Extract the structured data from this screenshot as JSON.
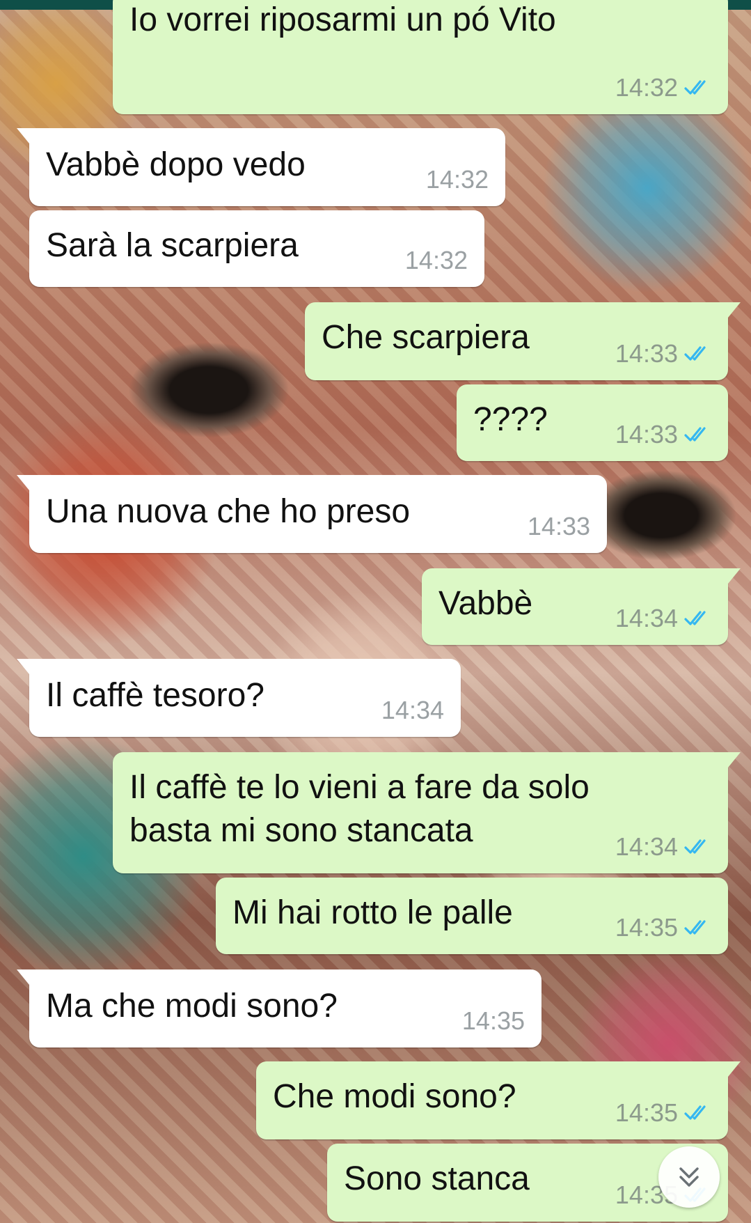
{
  "colors": {
    "outgoing_bubble": "#dcf8c6",
    "incoming_bubble": "#ffffff",
    "read_ticks": "#34b7f1",
    "header_strip": "#0f4f48"
  },
  "icons": {
    "read_receipt": "double-check-icon",
    "scroll_down": "double-chevron-down-icon"
  },
  "messages": [
    {
      "direction": "out",
      "text": "Io vorrei riposarmi un pó Vito",
      "time": "14:32",
      "read": true
    },
    {
      "direction": "in",
      "text": "Vabbè dopo vedo",
      "time": "14:32"
    },
    {
      "direction": "in",
      "text": "Sarà la scarpiera",
      "time": "14:32"
    },
    {
      "direction": "out",
      "text": "Che scarpiera",
      "time": "14:33",
      "read": true
    },
    {
      "direction": "out",
      "text": "????",
      "time": "14:33",
      "read": true
    },
    {
      "direction": "in",
      "text": "Una nuova che ho preso",
      "time": "14:33"
    },
    {
      "direction": "out",
      "text": "Vabbè",
      "time": "14:34",
      "read": true
    },
    {
      "direction": "in",
      "text": "Il caffè tesoro?",
      "time": "14:34"
    },
    {
      "direction": "out",
      "text_lines": [
        "Il caffè te lo vieni a fare da solo",
        "basta mi sono stancata"
      ],
      "time": "14:34",
      "read": true
    },
    {
      "direction": "out",
      "text": "Mi hai rotto le palle",
      "time": "14:35",
      "read": true
    },
    {
      "direction": "in",
      "text": "Ma che modi sono?",
      "time": "14:35"
    },
    {
      "direction": "out",
      "text": "Che modi sono?",
      "time": "14:35",
      "read": true
    },
    {
      "direction": "out",
      "text": "Sono stanca",
      "time": "14:35",
      "read": true
    }
  ]
}
